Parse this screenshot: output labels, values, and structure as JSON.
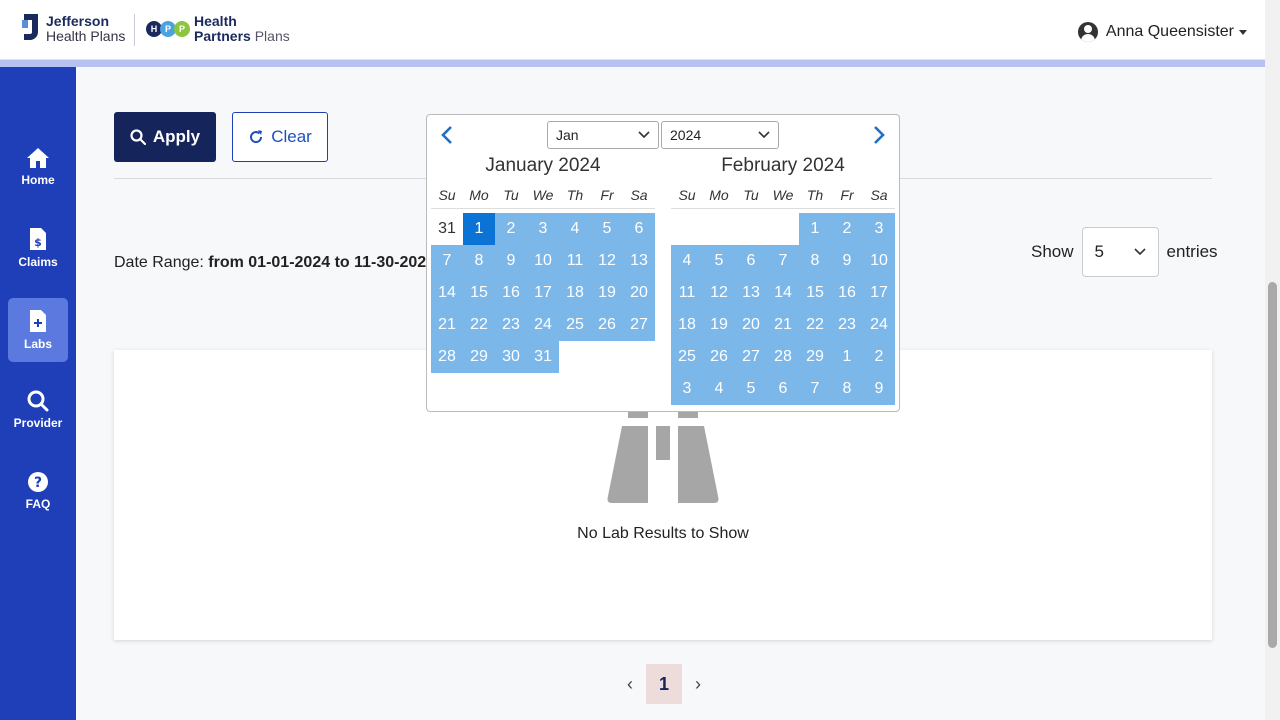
{
  "header": {
    "logo1_line1": "Jefferson",
    "logo1_line2": "Health Plans",
    "logo2_letters": [
      "H",
      "P",
      "P"
    ],
    "logo2_line1": "Health",
    "logo2_line2a": "Partners",
    "logo2_line2b": "Plans",
    "user_name": "Anna Queensister"
  },
  "sidebar": {
    "items": [
      {
        "label": "Home",
        "icon": "home-icon"
      },
      {
        "label": "Claims",
        "icon": "claims-icon"
      },
      {
        "label": "Labs",
        "icon": "labs-icon",
        "active": true
      },
      {
        "label": "Provider",
        "icon": "search-icon"
      },
      {
        "label": "FAQ",
        "icon": "question-icon"
      }
    ]
  },
  "filters": {
    "apply_label": "Apply",
    "clear_label": "Clear"
  },
  "date_range": {
    "prefix": "Date Range: ",
    "value": "from 01-01-2024 to 11-30-202"
  },
  "entries": {
    "show_label": "Show",
    "value": "5",
    "suffix": "entries"
  },
  "results": {
    "empty_text": "No Lab Results to Show"
  },
  "pagination": {
    "prev": "‹",
    "current": "1",
    "next": "›"
  },
  "datepicker": {
    "month_select": "Jan",
    "year_select": "2024",
    "weekdays": [
      "Su",
      "Mo",
      "Tu",
      "We",
      "Th",
      "Fr",
      "Sa"
    ],
    "left": {
      "title": "January 2024",
      "days": [
        {
          "d": "31",
          "s": "plain"
        },
        {
          "d": "1",
          "s": "sel-start"
        },
        {
          "d": "2",
          "s": "inrange"
        },
        {
          "d": "3",
          "s": "inrange"
        },
        {
          "d": "4",
          "s": "inrange"
        },
        {
          "d": "5",
          "s": "inrange"
        },
        {
          "d": "6",
          "s": "inrange"
        },
        {
          "d": "7",
          "s": "inrange"
        },
        {
          "d": "8",
          "s": "inrange"
        },
        {
          "d": "9",
          "s": "inrange"
        },
        {
          "d": "10",
          "s": "inrange"
        },
        {
          "d": "11",
          "s": "inrange"
        },
        {
          "d": "12",
          "s": "inrange"
        },
        {
          "d": "13",
          "s": "inrange"
        },
        {
          "d": "14",
          "s": "inrange"
        },
        {
          "d": "15",
          "s": "inrange"
        },
        {
          "d": "16",
          "s": "inrange"
        },
        {
          "d": "17",
          "s": "inrange"
        },
        {
          "d": "18",
          "s": "inrange"
        },
        {
          "d": "19",
          "s": "inrange"
        },
        {
          "d": "20",
          "s": "inrange"
        },
        {
          "d": "21",
          "s": "inrange"
        },
        {
          "d": "22",
          "s": "inrange"
        },
        {
          "d": "23",
          "s": "inrange"
        },
        {
          "d": "24",
          "s": "inrange"
        },
        {
          "d": "25",
          "s": "inrange"
        },
        {
          "d": "26",
          "s": "inrange"
        },
        {
          "d": "27",
          "s": "inrange"
        },
        {
          "d": "28",
          "s": "inrange"
        },
        {
          "d": "29",
          "s": "inrange"
        },
        {
          "d": "30",
          "s": "inrange"
        },
        {
          "d": "31",
          "s": "inrange"
        }
      ]
    },
    "right": {
      "title": "February 2024",
      "days": [
        {
          "d": "",
          "s": "empty"
        },
        {
          "d": "",
          "s": "empty"
        },
        {
          "d": "",
          "s": "empty"
        },
        {
          "d": "",
          "s": "empty"
        },
        {
          "d": "1",
          "s": "inrange"
        },
        {
          "d": "2",
          "s": "inrange"
        },
        {
          "d": "3",
          "s": "inrange"
        },
        {
          "d": "4",
          "s": "inrange"
        },
        {
          "d": "5",
          "s": "inrange"
        },
        {
          "d": "6",
          "s": "inrange"
        },
        {
          "d": "7",
          "s": "inrange"
        },
        {
          "d": "8",
          "s": "inrange"
        },
        {
          "d": "9",
          "s": "inrange"
        },
        {
          "d": "10",
          "s": "inrange"
        },
        {
          "d": "11",
          "s": "inrange"
        },
        {
          "d": "12",
          "s": "inrange"
        },
        {
          "d": "13",
          "s": "inrange"
        },
        {
          "d": "14",
          "s": "inrange"
        },
        {
          "d": "15",
          "s": "inrange"
        },
        {
          "d": "16",
          "s": "inrange"
        },
        {
          "d": "17",
          "s": "inrange"
        },
        {
          "d": "18",
          "s": "inrange"
        },
        {
          "d": "19",
          "s": "inrange"
        },
        {
          "d": "20",
          "s": "inrange"
        },
        {
          "d": "21",
          "s": "inrange"
        },
        {
          "d": "22",
          "s": "inrange"
        },
        {
          "d": "23",
          "s": "inrange"
        },
        {
          "d": "24",
          "s": "inrange"
        },
        {
          "d": "25",
          "s": "inrange"
        },
        {
          "d": "26",
          "s": "inrange"
        },
        {
          "d": "27",
          "s": "inrange"
        },
        {
          "d": "28",
          "s": "inrange"
        },
        {
          "d": "29",
          "s": "inrange"
        },
        {
          "d": "1",
          "s": "inrange"
        },
        {
          "d": "2",
          "s": "inrange"
        },
        {
          "d": "3",
          "s": "inrange"
        },
        {
          "d": "4",
          "s": "inrange"
        },
        {
          "d": "5",
          "s": "inrange"
        },
        {
          "d": "6",
          "s": "inrange"
        },
        {
          "d": "7",
          "s": "inrange"
        },
        {
          "d": "8",
          "s": "inrange"
        },
        {
          "d": "9",
          "s": "inrange"
        }
      ]
    }
  },
  "colors": {
    "sidebar": "#1f3fb8",
    "sidebar_active": "#5c79e0",
    "apply_button": "#15245a",
    "range_day": "#7cb7ea",
    "selected_day": "#0b72d6"
  }
}
